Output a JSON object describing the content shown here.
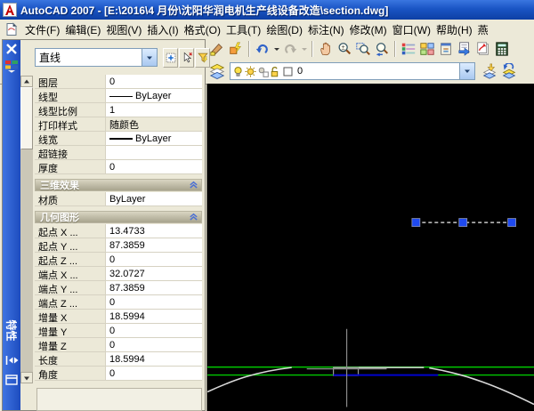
{
  "window": {
    "title": "AutoCAD 2007 - [E:\\2016\\4 月份\\沈阳华润电机生产线设备改造\\section.dwg]"
  },
  "menu": {
    "items": [
      "文件(F)",
      "编辑(E)",
      "视图(V)",
      "插入(I)",
      "格式(O)",
      "工具(T)",
      "绘图(D)",
      "标注(N)",
      "修改(M)",
      "窗口(W)",
      "帮助(H)",
      "燕"
    ]
  },
  "toolbars": {
    "standard_icons": [
      "match-properties-icon",
      "block-editor-icon",
      "|",
      "undo-icon",
      "undo-dropdown-icon",
      "redo-icon",
      "redo-dropdown-icon",
      "|",
      "pan-realtime-icon",
      "zoom-realtime-icon",
      "zoom-window-icon",
      "zoom-previous-icon",
      "|",
      "properties-icon",
      "designcenter-icon",
      "tool-palettes-icon",
      "sheetset-manager-icon",
      "markup-set-manager-icon",
      "quickcalc-icon"
    ],
    "layers": {
      "manager_icon": "layer-properties-manager-icon",
      "combo_icons": [
        "layer-on-icon",
        "layer-thaw-icon",
        "layer-vp-thaw-icon",
        "layer-unlock-icon",
        "layer-color-swatch"
      ],
      "current_layer": "0",
      "right_icons": [
        "make-object-layer-current-icon",
        "layer-previous-icon"
      ]
    }
  },
  "palette": {
    "title": "特性",
    "object_type": "直线",
    "header_buttons": [
      "pickadd-toggle-icon",
      "select-objects-icon",
      "quick-select-icon"
    ],
    "sections": [
      {
        "rows": [
          {
            "label": "图层",
            "value": "0"
          },
          {
            "label": "线型",
            "value": "ByLayer",
            "swatch": "thin"
          },
          {
            "label": "线型比例",
            "value": "1"
          },
          {
            "label": "打印样式",
            "value": "随颜色",
            "readonly": true
          },
          {
            "label": "线宽",
            "value": "ByLayer",
            "swatch": "thick"
          },
          {
            "label": "超链接",
            "value": ""
          },
          {
            "label": "厚度",
            "value": "0"
          }
        ]
      },
      {
        "header": "三维效果",
        "rows": [
          {
            "label": "材质",
            "value": "ByLayer"
          }
        ]
      },
      {
        "header": "几何图形",
        "rows": [
          {
            "label": "起点 X ...",
            "value": "13.4733"
          },
          {
            "label": "起点 Y ...",
            "value": "87.3859"
          },
          {
            "label": "起点 Z ...",
            "value": "0"
          },
          {
            "label": "端点 X ...",
            "value": "32.0727"
          },
          {
            "label": "端点 Y ...",
            "value": "87.3859"
          },
          {
            "label": "端点 Z ...",
            "value": "0"
          },
          {
            "label": "增量 X",
            "value": "18.5994"
          },
          {
            "label": "增量 Y",
            "value": "0"
          },
          {
            "label": "增量 Z",
            "value": "0"
          },
          {
            "label": "长度",
            "value": "18.5994"
          },
          {
            "label": "角度",
            "value": "0"
          }
        ]
      }
    ]
  },
  "drawing": {
    "selected_object": "直线",
    "grips_count": 3,
    "colors": {
      "background": "#000000",
      "grip": "#1f4af0",
      "dashed_selection": "#c8c8c8",
      "green_line": "#00c800",
      "blue_line": "#0000cc",
      "arc_white": "#d8d8d8",
      "crosshair": "#8a8a8a",
      "notch": "#9a9a9a"
    }
  }
}
